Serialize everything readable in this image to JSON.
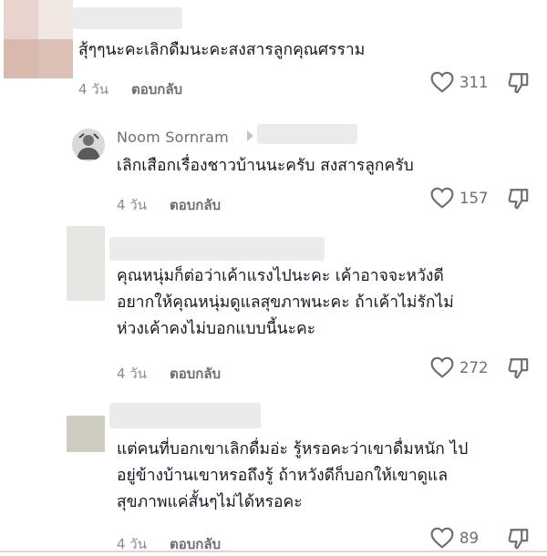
{
  "comments": [
    {
      "text": "สุ้ๆๆนะคะเลิกดืมนะคะสงสารลูกคุณศรราม",
      "time": "4 วัน",
      "reply_label": "ตอบกลับ",
      "likes": "311",
      "colors": {
        "avatar_a": "#e6d2cb",
        "avatar_b": "#d7b7ac"
      }
    },
    {
      "username": "Noom Sornram",
      "text": "เลิกเสือกเรื่องชาวบ้านนะครับ สงสารลูกครับ",
      "time": "4 วัน",
      "reply_label": "ตอบกลับ",
      "likes": "157"
    },
    {
      "text_lines": [
        "คุณหนุ่มก็ต่อว่าเค้าแรงไปนะคะ เค้าอาจจะหวังดี",
        "อยากให้คุณหนุ่มดูแลสุขภาพนะคะ ถ้าเค้าไม่รักไม่",
        "ห่วงเค้าคงไม่บอกแบบนี้นะคะ"
      ],
      "time": "4 วัน",
      "reply_label": "ตอบกลับ",
      "likes": "272",
      "colors": {
        "avatar": "#e8e6e2"
      }
    },
    {
      "text_lines": [
        "แต่คนที่บอกเขาเลิกดื่มอ่ะ รู้หรอคะว่าเขาดื่มหนัก ไป",
        "อยู่ข้างบ้านเขาหรอถึงรู้ ถ้าหวังดีก็บอกให้เขาดูแล",
        "สุขภาพแค่สั้นๆไม่ได้หรอคะ"
      ],
      "time": "4 วัน",
      "reply_label": "ตอบกลับ",
      "likes": "89",
      "colors": {
        "avatar": "#cfccc2"
      }
    }
  ],
  "icons": {
    "like": "heart-outline-icon",
    "dislike": "thumbs-down-icon",
    "more": "caret-right-icon"
  }
}
